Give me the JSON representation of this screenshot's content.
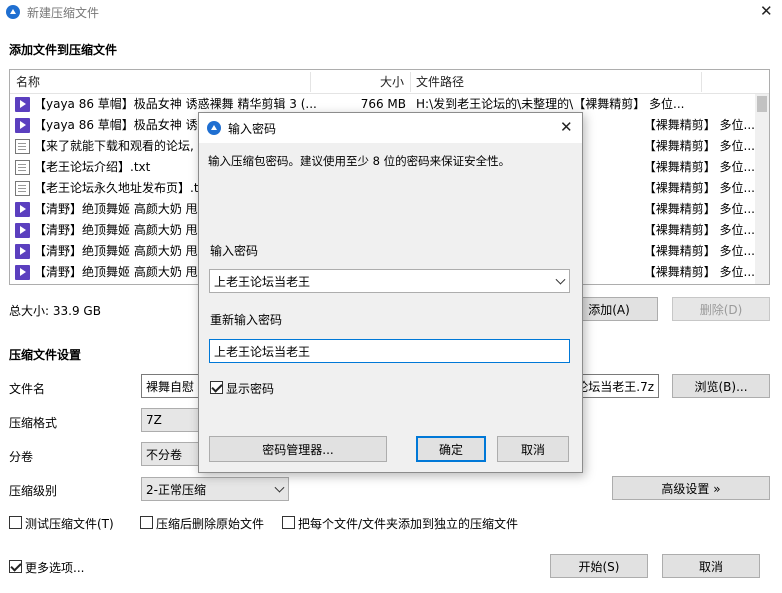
{
  "window": {
    "title": "新建压缩文件",
    "close_glyph": "✕"
  },
  "files_section": {
    "heading": "添加文件到压缩文件",
    "columns": {
      "name": "名称",
      "size": "大小",
      "path": "文件路径"
    },
    "rows": [
      {
        "type": "mp4",
        "name": "【yaya 86 草帽】极品女神 诱惑裸舞 精华剪辑 3 (...",
        "size": "766 MB",
        "path": "H:\\发到老王论坛的\\未整理的\\【裸舞精剪】 多位..."
      },
      {
        "type": "mp4",
        "name": "【yaya 86 草帽】极品女神 诱惑",
        "size": "",
        "path": "【裸舞精剪】 多位..."
      },
      {
        "type": "txt",
        "name": "【来了就能下载和观看的论坛,",
        "size": "",
        "path": "【裸舞精剪】 多位..."
      },
      {
        "type": "txt",
        "name": "【老王论坛介绍】.txt",
        "size": "",
        "path": "【裸舞精剪】 多位..."
      },
      {
        "type": "txt",
        "name": "【老王论坛永久地址发布页】.tx",
        "size": "",
        "path": "【裸舞精剪】 多位..."
      },
      {
        "type": "mp4",
        "name": "【清野】绝顶舞姬 高颜大奶 甩",
        "size": "",
        "path": "【裸舞精剪】 多位..."
      },
      {
        "type": "mp4",
        "name": "【清野】绝顶舞姬 高颜大奶 甩",
        "size": "",
        "path": "【裸舞精剪】 多位..."
      },
      {
        "type": "mp4",
        "name": "【清野】绝顶舞姬 高颜大奶 甩",
        "size": "",
        "path": "【裸舞精剪】 多位..."
      },
      {
        "type": "mp4",
        "name": "【清野】绝顶舞姬 高颜大奶 甩",
        "size": "",
        "path": "【裸舞精剪】 多位..."
      }
    ],
    "total_size": "总大小: 33.9 GB",
    "add_button": "添加(A)",
    "delete_button": "删除(D)"
  },
  "settings": {
    "heading": "压缩文件设置",
    "filename_label": "文件名",
    "filename_value_left": "裸舞自慰",
    "filename_value_right": "论坛当老王.7z",
    "browse_button": "浏览(B)...",
    "format_label": "压缩格式",
    "format_value": "7Z",
    "split_label": "分卷",
    "split_value": "不分卷",
    "level_label": "压缩级别",
    "level_value": "2-正常压缩",
    "advanced_button": "高级设置 »",
    "test_checkbox": "测试压缩文件(T)",
    "delete_checkbox": "压缩后删除原始文件",
    "separate_checkbox": "把每个文件/文件夹添加到独立的压缩文件",
    "more_options": "更多选项...",
    "start_button": "开始(S)",
    "cancel_button": "取消"
  },
  "dialog": {
    "title": "输入密码",
    "close_glyph": "✕",
    "description": "输入压缩包密码。建议使用至少 8 位的密码来保证安全性。",
    "password_label": "输入密码",
    "password_value": "上老王论坛当老王",
    "confirm_label": "重新输入密码",
    "confirm_value": "上老王论坛当老王",
    "show_password": "显示密码",
    "show_password_checked": true,
    "manager_button": "密码管理器...",
    "ok_button": "确定",
    "cancel_button": "取消"
  },
  "colors": {
    "accent": "#0078d7",
    "app_icon": "#1f6fd1",
    "mp4_icon": "#5b3fbf"
  }
}
